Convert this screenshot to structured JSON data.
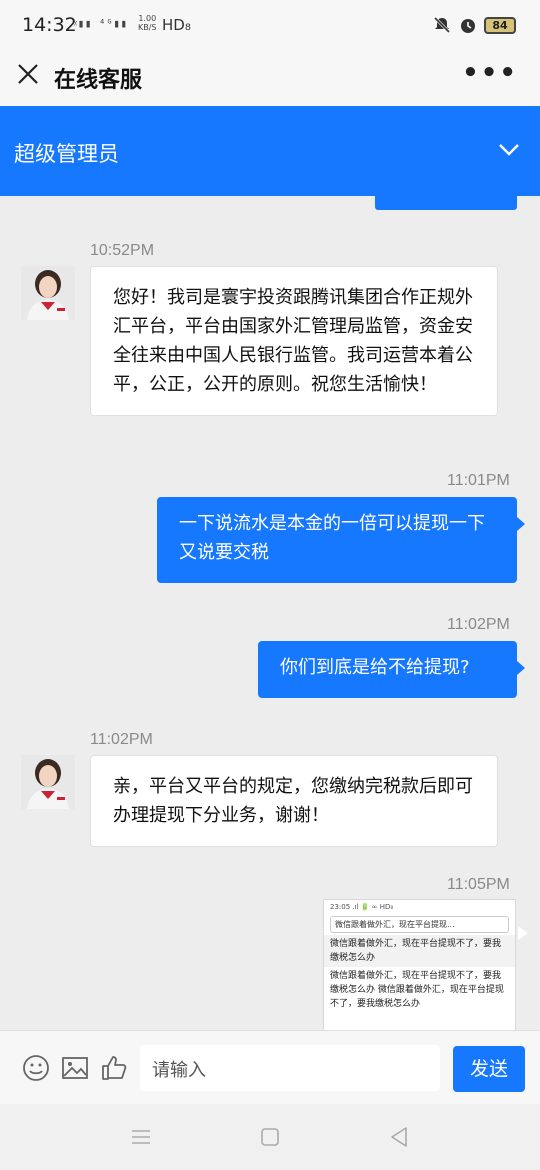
{
  "status_bar": {
    "time": "14:32",
    "net_icons": "ᵡ▮▮ ⁴ᴳ▮▮",
    "speed_top": "1.00",
    "speed_bottom": "KB/S",
    "hd": "HD₈",
    "battery": "84",
    "icons": [
      "mute-icon",
      "alarm-icon"
    ]
  },
  "header": {
    "title": "在线客服",
    "more": "•••"
  },
  "blue_bar": {
    "title": "超级管理员"
  },
  "messages": [
    {
      "time": "10:52PM",
      "direction": "incoming",
      "text": "您好！我司是寰宇投资跟腾讯集团合作正规外汇平台，平台由国家外汇管理局监管，资金安全往来由中国人民银行监管。我司运营本着公平，公正，公开的原则。祝您生活愉快！"
    },
    {
      "time": "11:01PM",
      "direction": "outgoing",
      "text": "一下说流水是本金的一倍可以提现一下又说要交税"
    },
    {
      "time": "11:02PM",
      "direction": "outgoing",
      "text": "你们到底是给不给提现?"
    },
    {
      "time": "11:02PM",
      "direction": "incoming",
      "text": "亲，平台又平台的规定，您缴纳完税款后即可办理提现下分业务，谢谢！"
    },
    {
      "time": "11:05PM",
      "direction": "outgoing",
      "type": "image",
      "preview": {
        "status": "23:05 .ıl 🔋 ∞ HD₈",
        "search": "微信跟着做外汇，现在平台提现...",
        "lines": [
          "微信跟着做外汇，现在平台提现不了，要我缴税怎么办",
          "微信跟着做外汇，现在平台提现不了，要我缴税怎么办 微信跟着做外汇，现在平台提现不了，要我缴税怎么办"
        ]
      }
    }
  ],
  "input_bar": {
    "placeholder": "请输入",
    "send_label": "发送"
  },
  "colors": {
    "accent": "#1677ff",
    "background": "#ededed"
  }
}
